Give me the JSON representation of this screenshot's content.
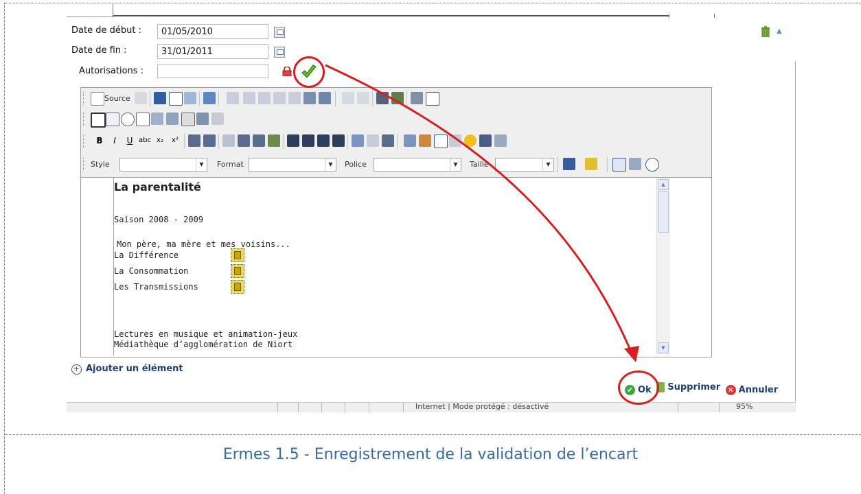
{
  "form": {
    "start_label": "Date de début :",
    "start_value": "01/05/2010",
    "end_label": "Date de fin :",
    "end_value": "31/01/2011",
    "auth_label": "Autorisations :",
    "auth_value": ""
  },
  "toolbar": {
    "source_label": "Source",
    "style_label": "Style",
    "format_label": "Format",
    "police_label": "Police",
    "taille_label": "Taille"
  },
  "content": {
    "title": "La parentalité",
    "season": "Saison 2008 - 2009",
    "intro": "Mon père, ma mère et mes voisins...",
    "items": [
      "La Différence",
      "La Consommation",
      "Les Transmissions"
    ],
    "footer1": "Lectures en musique et animation-jeux",
    "footer2": "Médiathèque d’agglomération de Niort"
  },
  "actions": {
    "add_element": "Ajouter un élément",
    "ok": "Ok",
    "delete": "Supprimer",
    "cancel": "Annuler"
  },
  "statusbar": {
    "zone": "Internet | Mode protégé : désactivé",
    "zoom": "95%"
  },
  "caption": "Ermes 1.5 - Enregistrement de la validation de l’encart",
  "colors": {
    "annotation_red": "#d42020",
    "caption_blue": "#3b6a9c",
    "link_blue": "#1f3f6c",
    "ok_green": "#3aa83a",
    "cancel_red": "#d83838"
  }
}
